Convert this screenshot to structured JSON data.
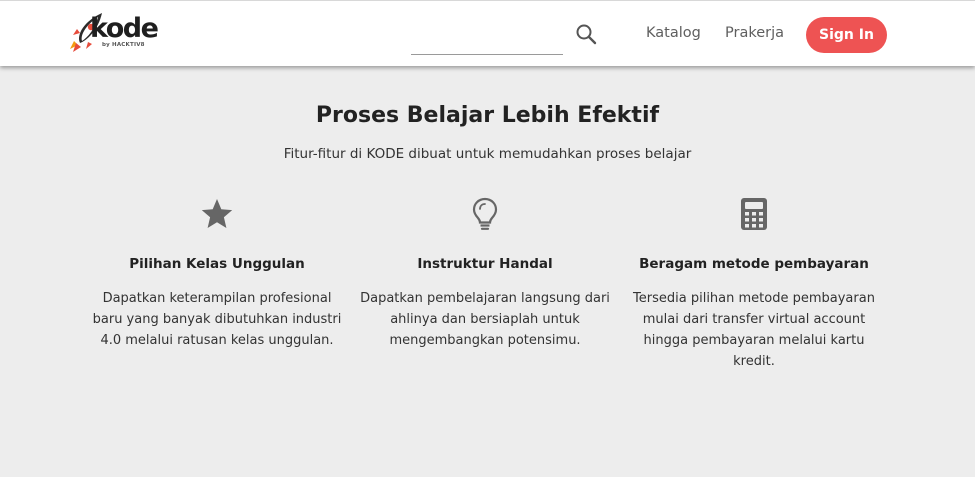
{
  "navbar": {
    "logo": {
      "word": "kode",
      "sub": "by HACKTIV8",
      "icon": "rocket-icon"
    },
    "search": {
      "placeholder": "",
      "value": "",
      "icon": "search-icon"
    },
    "links": [
      "Katalog",
      "Prakerja"
    ],
    "signin_label": "Sign In",
    "signin_color": "#ee5353"
  },
  "section": {
    "title": "Proses Belajar Lebih Efektif",
    "subtitle": "Fitur-fitur di KODE dibuat untuk memudahkan proses belajar"
  },
  "features": [
    {
      "icon": "star-icon",
      "title": "Pilihan Kelas Unggulan",
      "desc": "Dapatkan keterampilan profesional baru yang banyak dibutuhkan industri 4.0 melalui ratusan kelas unggulan."
    },
    {
      "icon": "lightbulb-icon",
      "title": "Instruktur Handal",
      "desc": "Dapatkan pembelajaran langsung dari ahlinya dan bersiaplah untuk mengembangkan potensimu."
    },
    {
      "icon": "calculator-icon",
      "title": "Beragam metode pembayaran",
      "desc": "Tersedia pilihan metode pembayaran mulai dari transfer virtual account hingga pembayaran melalui kartu kredit."
    }
  ],
  "colors": {
    "background": "#ededed",
    "navbar": "#ffffff",
    "icon": "#666666",
    "accent": "#ee5353"
  }
}
